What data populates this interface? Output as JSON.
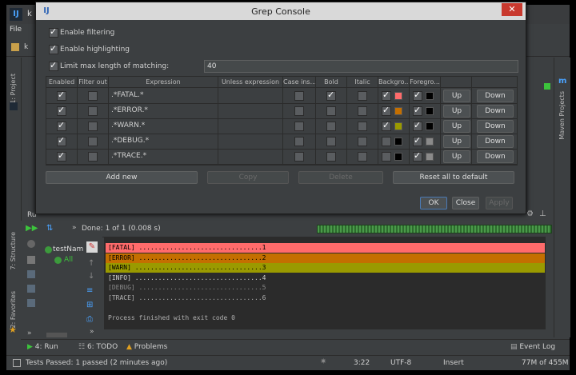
{
  "ide": {
    "title_k": "k",
    "menu_file": "File",
    "left_tabs": [
      "1: Project",
      "7: Structure",
      "2: Favorites"
    ],
    "right_tabs": [
      "Maven Projects"
    ],
    "run_header": "Ru"
  },
  "dialog": {
    "title": "Grep Console",
    "close_glyph": "✕",
    "enable_filtering": "Enable filtering",
    "enable_highlighting": "Enable highlighting",
    "limit_label": "Limit max length of matching:",
    "limit_value": "40",
    "columns": [
      "Enabled",
      "Filter out",
      "Expression",
      "Unless expression",
      "Case ins...",
      "Bold",
      "Italic",
      "Backgro...",
      "Foregro...",
      "",
      ""
    ],
    "rows": [
      {
        "expression": ".*FATAL.*",
        "bold": true,
        "bg": "#ff6b6b",
        "fg": "#000000",
        "bg_checked": true,
        "fg_checked": true
      },
      {
        "expression": ".*ERROR.*",
        "bold": false,
        "bg": "#c46f00",
        "fg": "#000000",
        "bg_checked": true,
        "fg_checked": true
      },
      {
        "expression": ".*WARN.*",
        "bold": false,
        "bg": "#9a9a00",
        "fg": "#000000",
        "bg_checked": true,
        "fg_checked": true
      },
      {
        "expression": ".*DEBUG.*",
        "bold": false,
        "bg": "#000000",
        "fg": "#8a8a8a",
        "bg_checked": false,
        "fg_checked": true
      },
      {
        "expression": ".*TRACE.*",
        "bold": false,
        "bg": "#000000",
        "fg": "#8a8a8a",
        "bg_checked": false,
        "fg_checked": true
      }
    ],
    "up_label": "Up",
    "down_label": "Down",
    "add_new": "Add new",
    "copy": "Copy",
    "delete": "Delete",
    "reset": "Reset all to default",
    "ok": "OK",
    "close": "Close",
    "apply": "Apply"
  },
  "run": {
    "done_text": "Done: 1 of 1 (0.008 s)",
    "tree_item": "testNam",
    "tree_all": "All",
    "console_lines": [
      {
        "text": "[FATAL] ................................1",
        "bg": "#ff6b6b",
        "fg": "#000000"
      },
      {
        "text": "[ERROR] ................................2",
        "bg": "#c46f00",
        "fg": "#000000"
      },
      {
        "text": "[WARN] .................................3",
        "bg": "#9a9a00",
        "fg": "#000000"
      },
      {
        "text": "[INFO] .................................4",
        "bg": "",
        "fg": "#d0d0d0"
      },
      {
        "text": "[DEBUG] ................................5",
        "bg": "",
        "fg": "#8a8a8a"
      },
      {
        "text": "[TRACE] ................................6",
        "bg": "",
        "fg": "#b0b0b0"
      },
      {
        "text": "",
        "bg": "",
        "fg": "#d0d0d0"
      },
      {
        "text": "Process finished with exit code 0",
        "bg": "",
        "fg": "#b0b0b0"
      }
    ]
  },
  "bottom_tabs": {
    "run": "4: Run",
    "todo": "6: TODO",
    "problems": "Problems",
    "event_log": "Event Log"
  },
  "status": {
    "message": "Tests Passed: 1 passed (2 minutes ago)",
    "position": "3:22",
    "encoding": "UTF-8",
    "mode": "Insert",
    "memory": "77M of 455M"
  }
}
